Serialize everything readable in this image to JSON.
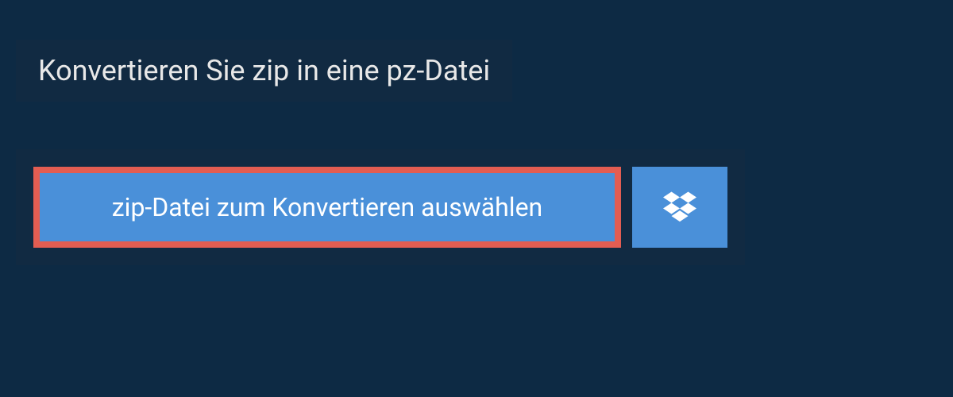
{
  "header": {
    "title": "Konvertieren Sie zip in eine pz-Datei"
  },
  "upload": {
    "select_button_label": "zip-Datei zum Konvertieren auswählen",
    "dropbox_icon": "dropbox-icon"
  },
  "colors": {
    "background": "#0d2a44",
    "panel": "#112a42",
    "button": "#4a90d9",
    "highlight_border": "#e35d52",
    "text_light": "#e8e8e8",
    "text_white": "#ffffff"
  }
}
